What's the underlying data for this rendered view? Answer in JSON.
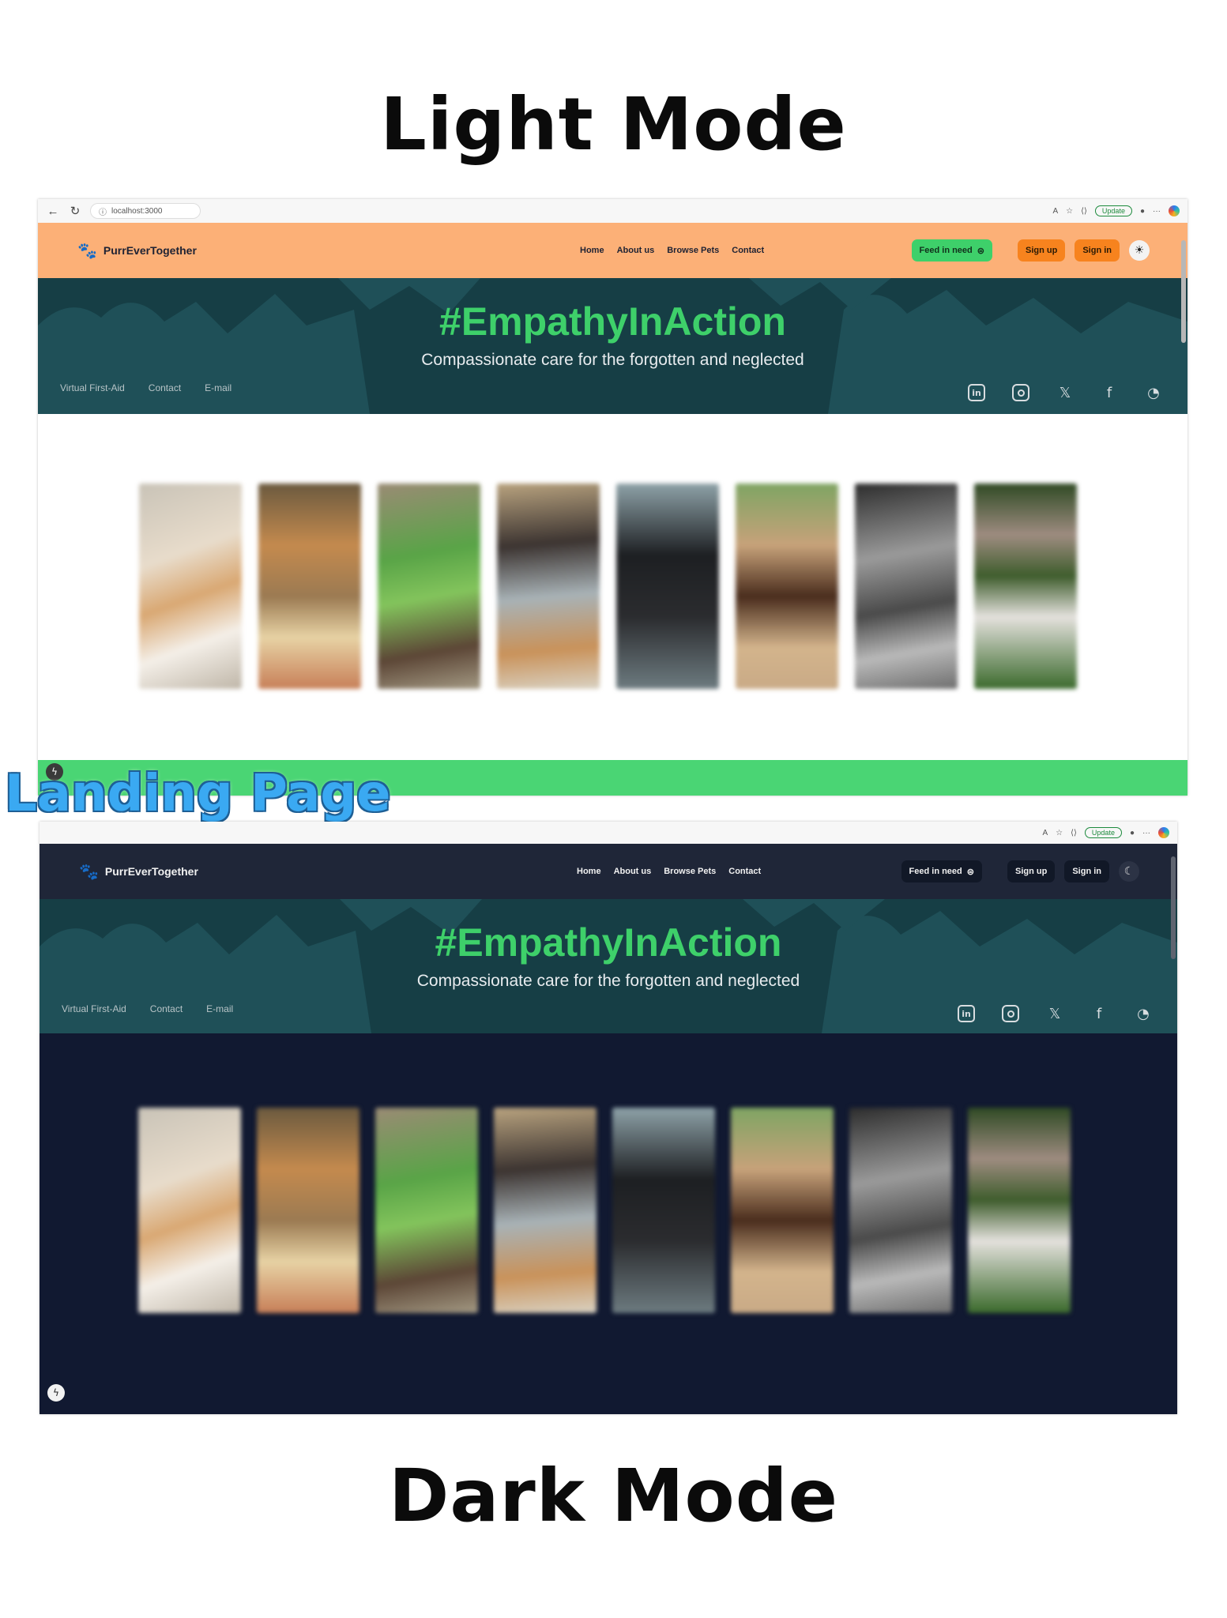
{
  "titles": {
    "light": "Light Mode",
    "dark": "Dark Mode",
    "section": "Landing Page"
  },
  "browser": {
    "address": "localhost:3000",
    "update_label": "Update"
  },
  "nav": {
    "brand": "PurrEverTogether",
    "links": [
      "Home",
      "About us",
      "Browse Pets",
      "Contact"
    ],
    "feed_button": "Feed in need",
    "signup_button": "Sign up",
    "signin_button": "Sign in"
  },
  "hero": {
    "headline": "#EmpathyInAction",
    "subtitle": "Compassionate care for the forgotten and neglected",
    "mini_links_light": [
      "Virtual First-Aid",
      "Contact",
      "E-mail"
    ],
    "mini_links_dark": [
      "Virtual First-Aid",
      "Contact",
      "E-mail"
    ],
    "social_icons": [
      "linkedin-icon",
      "instagram-icon",
      "x-icon",
      "facebook-icon",
      "github-icon"
    ]
  },
  "gallery": [
    "kitten",
    "deer",
    "parrot",
    "dog",
    "black-cat",
    "horse",
    "bird",
    "ducks"
  ],
  "colors": {
    "light_nav": "#fcb077",
    "dark_nav": "#1f2638",
    "hero_bg": "#163e45",
    "accent_green": "#3ed06a",
    "orange_button": "#f7831e",
    "dark_page": "#111931"
  }
}
